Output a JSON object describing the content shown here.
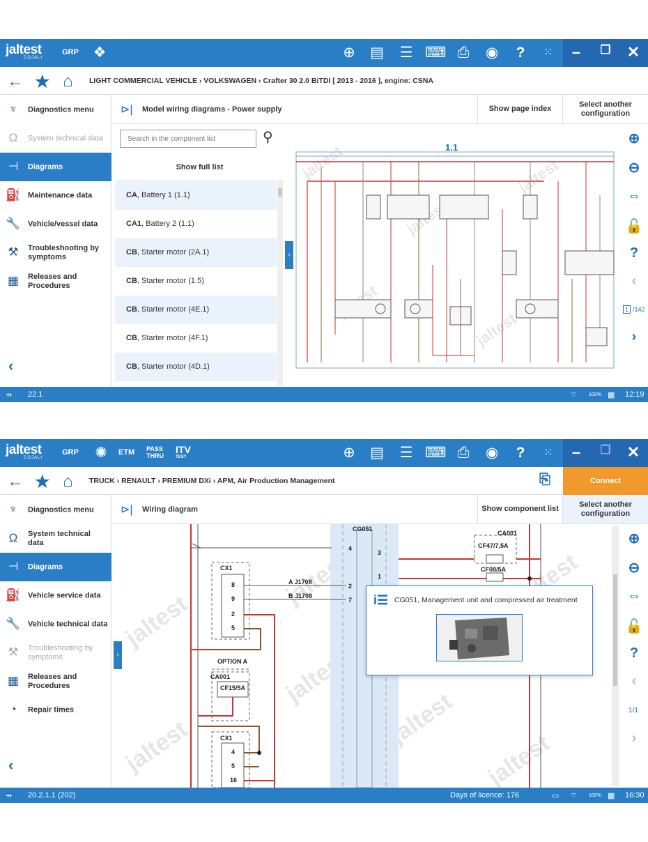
{
  "common": {
    "logo": "jaltest",
    "logo_sub": "COJALI",
    "grp": "GRP",
    "win_minimize": "–",
    "win_restore": "❐",
    "win_close": "✕",
    "apps_icon": "grid-icon"
  },
  "screen1": {
    "breadcrumb": "LIGHT COMMERCIAL VEHICLE  ›  VOLKSWAGEN  ›  Crafter 30 2.0 BiTDI [ 2013 - 2016 ], engine: CSNA",
    "sidebar": [
      {
        "label": "Diagnostics menu",
        "state": "normal"
      },
      {
        "label": "System technical data",
        "state": "disabled"
      },
      {
        "label": "Diagrams",
        "state": "active"
      },
      {
        "label": "Maintenance data",
        "state": "normal"
      },
      {
        "label": "Vehicle/vessel data",
        "state": "normal"
      },
      {
        "label": "Troubleshooting by symptoms",
        "state": "normal"
      },
      {
        "label": "Releases and Procedures",
        "state": "normal"
      }
    ],
    "header_title": "Model wiring diagrams - Power supply",
    "show_page_index": "Show page index",
    "select_config": "Select another configuration",
    "search_placeholder": "Search in the component list",
    "show_full_list": "Show full list",
    "components": [
      {
        "code": "CA",
        "name": ", Battery 1 (1.1)"
      },
      {
        "code": "CA1",
        "name": ", Battery 2 (1.1)"
      },
      {
        "code": "CB",
        "name": ", Starter motor (2A.1)"
      },
      {
        "code": "CB",
        "name": ", Starter motor (1.5)"
      },
      {
        "code": "CB",
        "name": ", Starter motor (4E.1)"
      },
      {
        "code": "CB",
        "name": ", Starter motor (4F.1)"
      },
      {
        "code": "CB",
        "name": ", Starter motor (4D.1)"
      }
    ],
    "diagram_page": "1.1",
    "page_current": "1",
    "page_total": "/142",
    "status_version": "22.1",
    "status_time": "12:19",
    "status_battery": "100%"
  },
  "screen2": {
    "tb_etm": "ETM",
    "tb_pass": "PASS",
    "tb_thru": "THRU",
    "tb_itv": "ITV",
    "tb_itv_sub": "TEST",
    "breadcrumb": "TRUCK  ›  RENAULT  ›  PREMIUM DXi  ›  APM, Air Production Management",
    "connect": "Connect",
    "sidebar": [
      {
        "label": "Diagnostics menu",
        "state": "normal"
      },
      {
        "label": "System technical data",
        "state": "normal"
      },
      {
        "label": "Diagrams",
        "state": "active"
      },
      {
        "label": "Vehicle service data",
        "state": "normal"
      },
      {
        "label": "Vehicle technical data",
        "state": "normal"
      },
      {
        "label": "Troubleshooting by symptoms",
        "state": "disabled"
      },
      {
        "label": "Releases and Procedures",
        "state": "normal"
      },
      {
        "label": "Repair times",
        "state": "normal"
      }
    ],
    "header_title": "Wiring diagram",
    "show_component_list": "Show component list",
    "select_config": "Select another configuration",
    "diagram_labels": {
      "cg051": "CG051",
      "ca001_top": "CA001",
      "cf47": "CF47/7,5A",
      "cf08": "CF08/5A",
      "cx1_top": "CX1",
      "pin8": "8",
      "pin9": "9",
      "pin2": "2",
      "pin5": "5",
      "aj1708": "A J1708",
      "bj1708": "B J1708",
      "cg_pin2": "2",
      "cg_pin7": "7",
      "cg_pin4": "4",
      "ca_pin3": "3",
      "ca_pin1": "1",
      "option_a": "OPTION A",
      "ca001_mid": "CA001",
      "cf15": "CF15/5A",
      "cx1_bot": "CX1",
      "pin4b": "4",
      "pin5b": "5",
      "pin16": "16"
    },
    "tooltip_text": "CG051, Management unit and compressed air treatment",
    "page_ind": "1/1",
    "status_version": "20.2.1.1 (202)",
    "days_licence": "Days of licence: 176",
    "status_time": "16:30",
    "status_battery": "100%"
  }
}
